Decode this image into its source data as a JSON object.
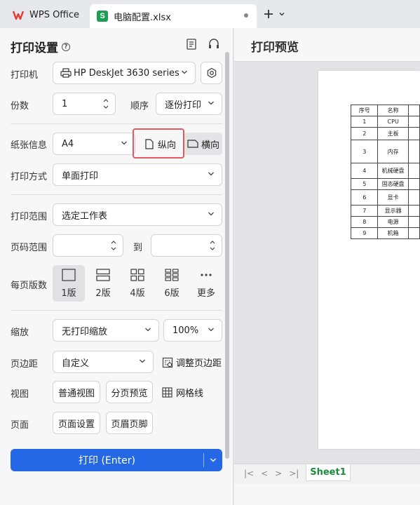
{
  "tabs": {
    "app_label": "WPS Office",
    "file_label": "电脑配置.xlsx",
    "file_logo": "S"
  },
  "panel": {
    "title": "打印设置",
    "printer": {
      "label": "打印机",
      "value": "HP DeskJet 3630 series"
    },
    "copies": {
      "label": "份数",
      "value": "1",
      "order_label": "顺序",
      "order_value": "逐份打印"
    },
    "paper": {
      "label": "纸张信息",
      "size": "A4",
      "portrait": "纵向",
      "landscape": "横向"
    },
    "mode": {
      "label": "打印方式",
      "value": "单面打印"
    },
    "range": {
      "label": "打印范围",
      "value": "选定工作表"
    },
    "page_range": {
      "label": "页码范围",
      "from_value": "",
      "to_label": "到",
      "to_value": ""
    },
    "pages_per_sheet": {
      "label": "每页版数",
      "options": [
        "1版",
        "2版",
        "4版",
        "6版",
        "更多"
      ],
      "selected": "1版"
    },
    "scale": {
      "label": "缩放",
      "value": "无打印缩放",
      "percent": "100%"
    },
    "margin": {
      "label": "页边距",
      "value": "自定义",
      "adjust": "调整页边距"
    },
    "view": {
      "label": "视图",
      "normal": "普通视图",
      "page_break": "分页预览",
      "gridlines": "网格线"
    },
    "page": {
      "label": "页面",
      "setup": "页面设置",
      "header_footer": "页眉页脚"
    },
    "print_button": "打印 (Enter)"
  },
  "preview": {
    "title": "打印预览",
    "table": {
      "headers": [
        "序号",
        "名称"
      ],
      "rows": [
        [
          "1",
          "CPU"
        ],
        [
          "2",
          "主板"
        ],
        [
          "3",
          "内存"
        ],
        [
          "4",
          "机械硬盘"
        ],
        [
          "5",
          "固态硬盘"
        ],
        [
          "6",
          "显卡"
        ],
        [
          "7",
          "显示器"
        ],
        [
          "8",
          "电源"
        ],
        [
          "9",
          "机箱"
        ]
      ]
    },
    "sheet_tab": "Sheet1"
  },
  "colors": {
    "accent": "#2468e5",
    "wps_red": "#e53935",
    "sheet_green": "#1f9d55",
    "highlight": "#e05a66"
  }
}
